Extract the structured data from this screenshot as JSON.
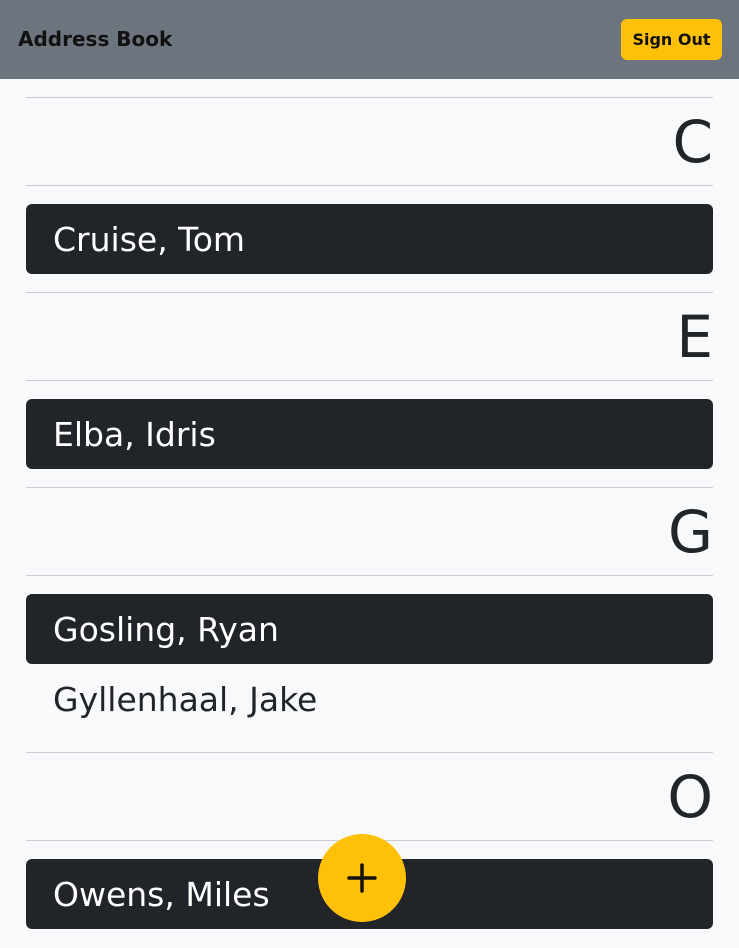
{
  "header": {
    "title": "Address Book",
    "sign_out_label": "Sign Out"
  },
  "sections": [
    {
      "letter": "C",
      "contacts": [
        {
          "name": "Cruise, Tom",
          "selected": true
        }
      ]
    },
    {
      "letter": "E",
      "contacts": [
        {
          "name": "Elba, Idris",
          "selected": true
        }
      ]
    },
    {
      "letter": "G",
      "contacts": [
        {
          "name": "Gosling, Ryan",
          "selected": true
        },
        {
          "name": "Gyllenhaal, Jake",
          "selected": false
        }
      ]
    },
    {
      "letter": "O",
      "contacts": [
        {
          "name": "Owens, Miles",
          "selected": true
        }
      ]
    }
  ],
  "colors": {
    "navbar": "#6c757d",
    "accent": "#ffc107",
    "dark": "#212529",
    "background": "#f8f9fa"
  },
  "fab": {
    "icon": "plus-icon"
  }
}
